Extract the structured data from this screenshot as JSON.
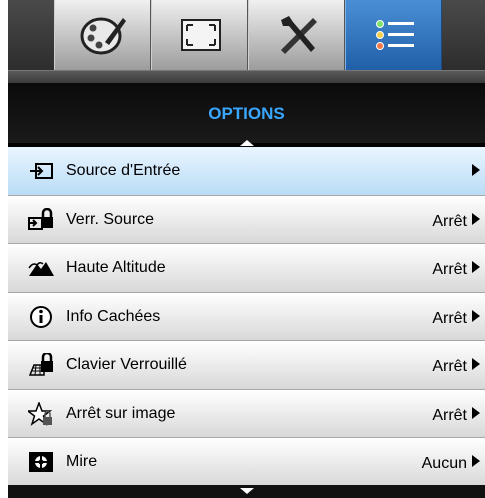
{
  "tabs": [
    {
      "name": "image-tab",
      "icon": "palette-icon",
      "active": false
    },
    {
      "name": "display-tab",
      "icon": "screen-resize-icon",
      "active": false
    },
    {
      "name": "setup-tab",
      "icon": "tools-icon",
      "active": false
    },
    {
      "name": "options-tab",
      "icon": "list-icon",
      "active": true
    }
  ],
  "title": "OPTIONS",
  "menu": [
    {
      "label": "Source d'Entrée",
      "value": "",
      "icon": "input-source-icon",
      "selected": true
    },
    {
      "label": "Verr. Source",
      "value": "Arrêt",
      "icon": "source-lock-icon",
      "selected": false
    },
    {
      "label": "Haute Altitude",
      "value": "Arrêt",
      "icon": "mountain-icon",
      "selected": false
    },
    {
      "label": "Info Cachées",
      "value": "Arrêt",
      "icon": "info-icon",
      "selected": false
    },
    {
      "label": "Clavier Verrouillé",
      "value": "Arrêt",
      "icon": "keypad-lock-icon",
      "selected": false
    },
    {
      "label": "Arrêt sur image",
      "value": "Arrêt",
      "icon": "freeze-star-icon",
      "selected": false
    },
    {
      "label": "Mire",
      "value": "Aucun",
      "icon": "test-pattern-icon",
      "selected": false
    }
  ],
  "colors": {
    "title": "#3aa6ff",
    "active_tab": "#2f78c4"
  }
}
